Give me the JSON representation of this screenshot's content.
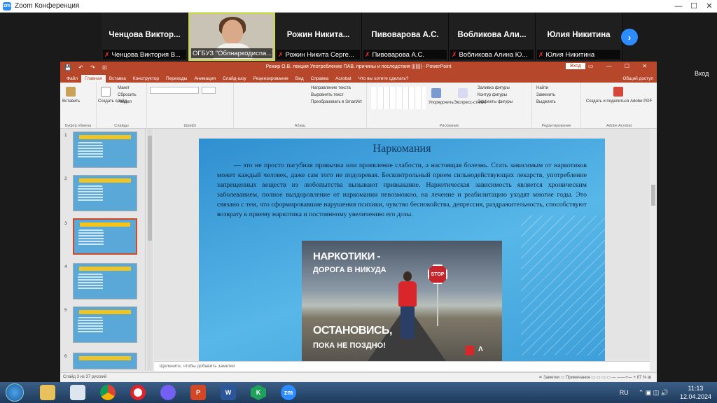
{
  "zoom": {
    "title": "Zoom Конференция",
    "logo": "zm",
    "minimize": "—",
    "maximize": "☐",
    "close": "✕"
  },
  "participants": [
    {
      "name": "Ченцова Виктор...",
      "label": "Ченцова Виктория В...",
      "video": false
    },
    {
      "name": "",
      "label": "ОГБУЗ \"Облнаркодиспа...",
      "video": true
    },
    {
      "name": "Рожин Никита...",
      "label": "Рожин Никита Серге...",
      "video": false
    },
    {
      "name": "Пивоварова А.С.",
      "label": "Пивоварова А.С.",
      "video": false
    },
    {
      "name": "Вобликова Али...",
      "label": "Вобликова Алина Ю...",
      "video": false
    },
    {
      "name": "Юлия Никитина",
      "label": "Юлия Никитина",
      "video": false
    }
  ],
  "next_icon": "›",
  "vhod": "Вход",
  "ppt": {
    "doc_title": "Режир О.В. лекция Употребление ПАВ. причины и последствия ||||||||  -  PowerPoint",
    "login": "Вход",
    "controls": "▭ — ☐ ✕",
    "quick_access": "💾 ↶ ↷ ⊡",
    "tabs": [
      "Файл",
      "Главная",
      "Вставка",
      "Конструктор",
      "Переходы",
      "Анимация",
      "Слайд-шоу",
      "Рецензирование",
      "Вид",
      "Справка",
      "Acrobat",
      "Что вы хотите сделать?"
    ],
    "share": "Общий доступ",
    "ribbon": {
      "paste": "Вставить",
      "clipboard": "Буфер обмена",
      "create_slide": "Создать слайд",
      "slides": "Слайды",
      "layout": "Макет",
      "reset": "Сбросить",
      "section": "Раздел",
      "font": "Шрифт",
      "paragraph": "Абзац",
      "text_dir": "Направление текста",
      "align_text": "Выровнять текст",
      "smartart": "Преобразовать в SmartArt",
      "drawing": "Рисование",
      "arrange": "Упорядочить",
      "styles": "Экспресс-стили",
      "fill": "Заливка фигуры",
      "outline": "Контур фигуры",
      "effects": "Эффекты фигуры",
      "find": "Найти",
      "replace": "Заменить",
      "select": "Выделить",
      "editing": "Редактирование",
      "adobe": "Создать и поделиться Adobe PDF",
      "acrobat": "Adobe Acrobat"
    },
    "slide_numbers": [
      "1",
      "2",
      "3",
      "4",
      "5",
      "6"
    ],
    "slide": {
      "title": "Наркомания",
      "text": "— это не просто пагубная привычка или проявление слабости, а настоящая болезнь. Стать зависимым от наркотиков может каждый человек, даже сам того не подозревая. Бесконтрольный прием сильнодействующих лекарств, употребление запрещенных веществ из любопытства вызывают привыкание. Наркотическая зависимость является хроническим заболеванием, полное выздоровление от наркомании невозможно, на лечение и реабилитацию уходят многие годы. Это связано с тем, что сформировавшие нарушения психики, чувство беспокойства, депрессия, раздражительность, способствуют возврату к приему наркотика и постоянному увеличению его дозы.",
      "poster": {
        "line1": "НАРКОТИКИ -",
        "line2": "ДОРОГА В НИКУДА",
        "line3": "ОСТАНОВИСЬ,",
        "line4": "ПОКА НЕ ПОЗДНО!",
        "stop": "STOP"
      }
    },
    "notes": "Щелкните, чтобы добавить заметки",
    "status_left": "Слайд 3 из 37    русский",
    "status_right": "≐ Заметки    ▭ Примечания    ▭ ▭ ▭ ▭   — ——+— + 87 %   ⊞"
  },
  "taskbar": {
    "lang": "RU",
    "time": "11:13",
    "date": "12.04.2024",
    "tray_icons": "⌃ ▣ ◫ 🔊"
  }
}
